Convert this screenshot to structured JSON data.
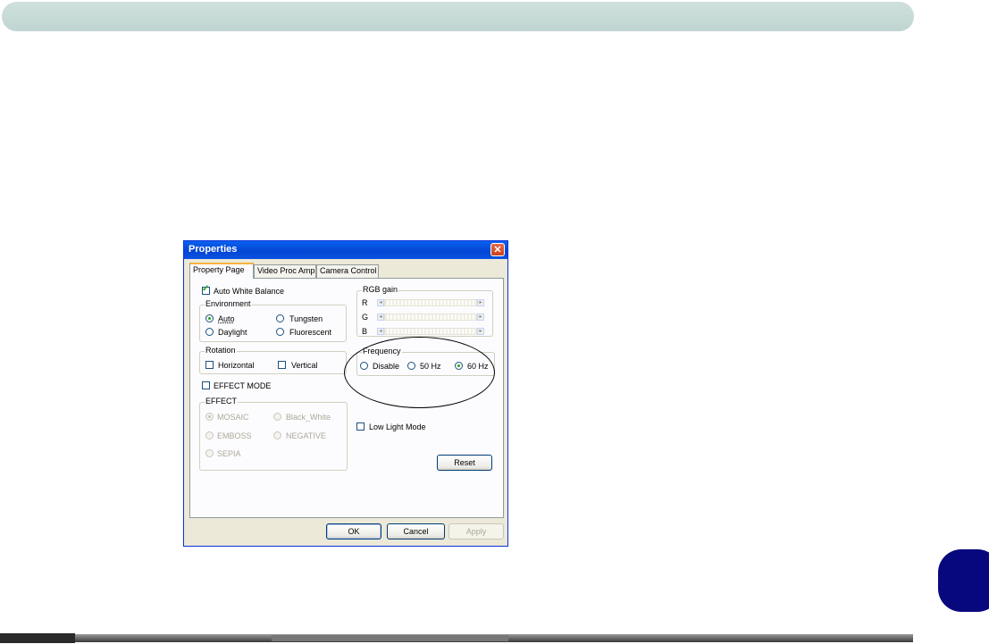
{
  "dialog": {
    "title": "Properties",
    "tabs": [
      "Property Page",
      "Video Proc Amp",
      "Camera Control"
    ],
    "auto_white_balance": {
      "label": "Auto White Balance",
      "checked": true
    },
    "environment": {
      "legend": "Environment",
      "options": [
        "Auto",
        "Tungsten",
        "Daylight",
        "Fluorescent"
      ],
      "selected": "Auto"
    },
    "rgb_gain": {
      "legend": "RGB gain",
      "channels": [
        "R",
        "G",
        "B"
      ]
    },
    "rotation": {
      "legend": "Rotation",
      "horizontal": "Horizontal",
      "vertical": "Vertical"
    },
    "frequency": {
      "legend": "Frequency",
      "options": [
        "Disable",
        "50 Hz",
        "60 Hz"
      ],
      "selected": "60 Hz"
    },
    "effect_mode": {
      "label": "EFFECT MODE",
      "checked": false
    },
    "effect": {
      "legend": "EFFECT",
      "options": [
        "MOSAIC",
        "Black_White",
        "EMBOSS",
        "NEGATIVE",
        "SEPIA"
      ],
      "selected": "MOSAIC"
    },
    "low_light_mode": {
      "label": "Low Light Mode",
      "checked": false
    },
    "buttons": {
      "reset": "Reset",
      "ok": "OK",
      "cancel": "Cancel",
      "apply": "Apply"
    },
    "close_symbol": "✕"
  }
}
